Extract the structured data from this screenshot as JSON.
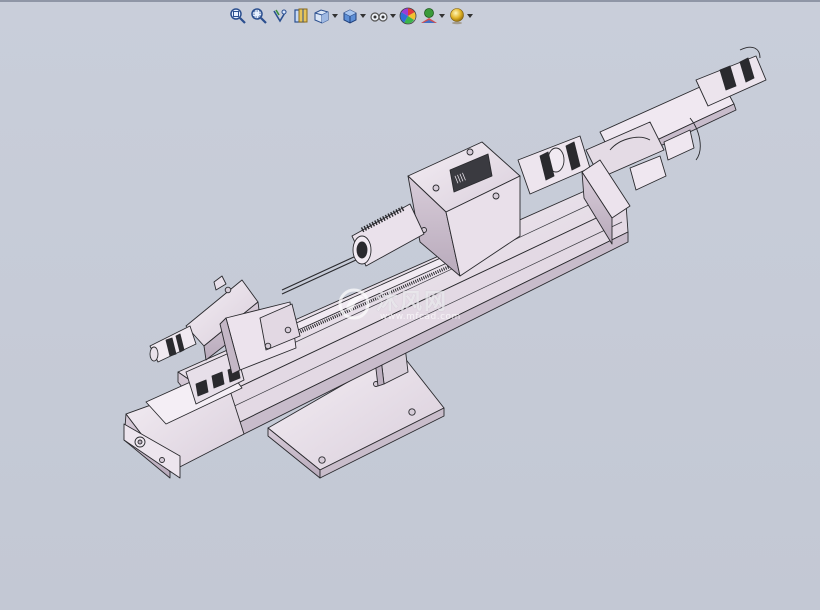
{
  "window": {
    "background": "#c5cad6",
    "accent": "#8f96a6"
  },
  "toolbar": {
    "buttons": [
      {
        "id": "zoom-to-fit",
        "icon": "zoom-to-fit-icon"
      },
      {
        "id": "zoom-to-area",
        "icon": "zoom-to-area-icon"
      },
      {
        "id": "previous-view",
        "icon": "previous-view-icon"
      },
      {
        "id": "section-view",
        "icon": "section-view-icon"
      },
      {
        "id": "view-orientation",
        "icon": "view-orientation-icon",
        "dropdown": true
      },
      {
        "id": "display-style",
        "icon": "display-style-icon",
        "dropdown": true
      },
      {
        "id": "hide-show-items",
        "icon": "hide-show-items-icon",
        "dropdown": true
      },
      {
        "id": "edit-appearance",
        "icon": "edit-appearance-icon"
      },
      {
        "id": "apply-scene",
        "icon": "apply-scene-icon",
        "dropdown": true
      },
      {
        "id": "view-settings",
        "icon": "view-settings-icon",
        "dropdown": true
      }
    ]
  },
  "watermark": {
    "text": "沐风网",
    "url": "www.mfcad.com"
  }
}
